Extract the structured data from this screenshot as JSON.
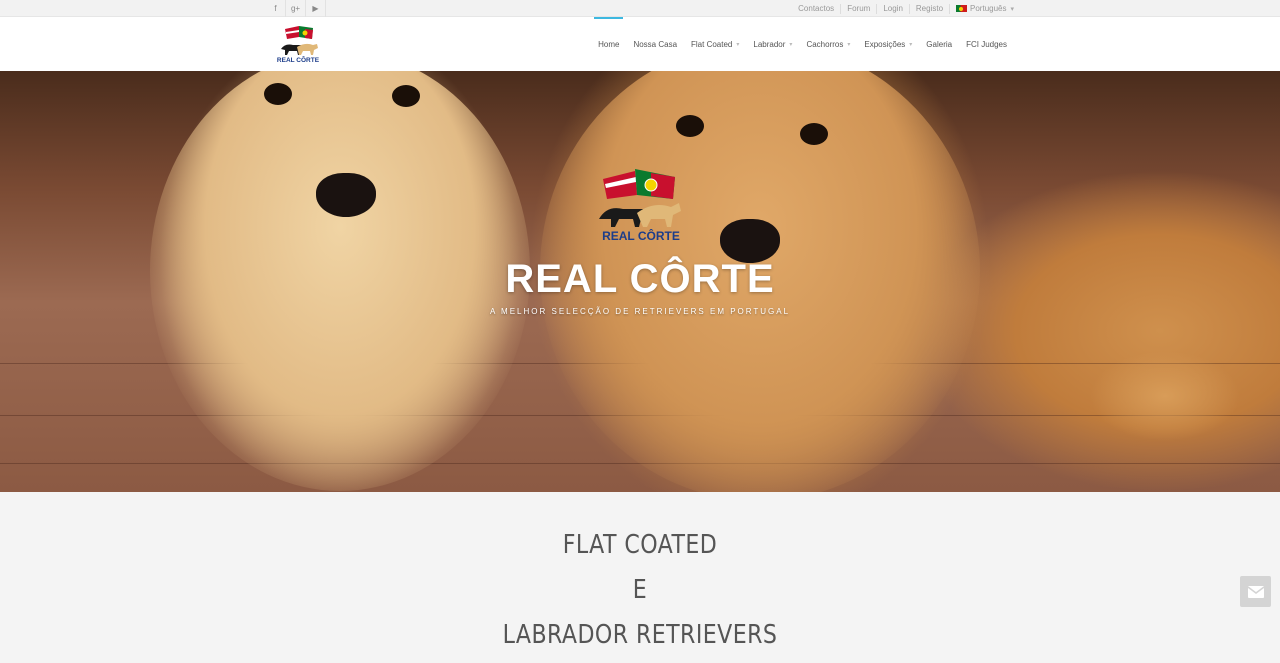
{
  "topbar": {
    "social": [
      {
        "icon": "facebook-icon",
        "glyph": "f"
      },
      {
        "icon": "google-plus-icon",
        "glyph": "g+"
      },
      {
        "icon": "youtube-icon",
        "glyph": "▶"
      }
    ],
    "links": [
      "Contactos",
      "Forum",
      "Login",
      "Registo"
    ],
    "language": "Português"
  },
  "nav": {
    "items": [
      {
        "label": "Home",
        "active": true,
        "dropdown": false
      },
      {
        "label": "Nossa Casa",
        "active": false,
        "dropdown": false
      },
      {
        "label": "Flat Coated",
        "active": false,
        "dropdown": true
      },
      {
        "label": "Labrador",
        "active": false,
        "dropdown": true
      },
      {
        "label": "Cachorros",
        "active": false,
        "dropdown": true
      },
      {
        "label": "Exposições",
        "active": false,
        "dropdown": true
      },
      {
        "label": "Galeria",
        "active": false,
        "dropdown": false
      },
      {
        "label": "FCI Judges",
        "active": false,
        "dropdown": false
      }
    ],
    "accent": "#3db8e0"
  },
  "logo": {
    "text": "REAL CÔRTE"
  },
  "hero": {
    "title": "REAL CÔRTE",
    "subtitle": "A MELHOR SELECÇÃO DE RETRIEVERS EM PORTUGAL"
  },
  "content": {
    "line1": "FLAT COATED",
    "line2": "E",
    "line3": "LABRADOR RETRIEVERS"
  },
  "contact_button": {
    "icon": "envelope-icon"
  }
}
